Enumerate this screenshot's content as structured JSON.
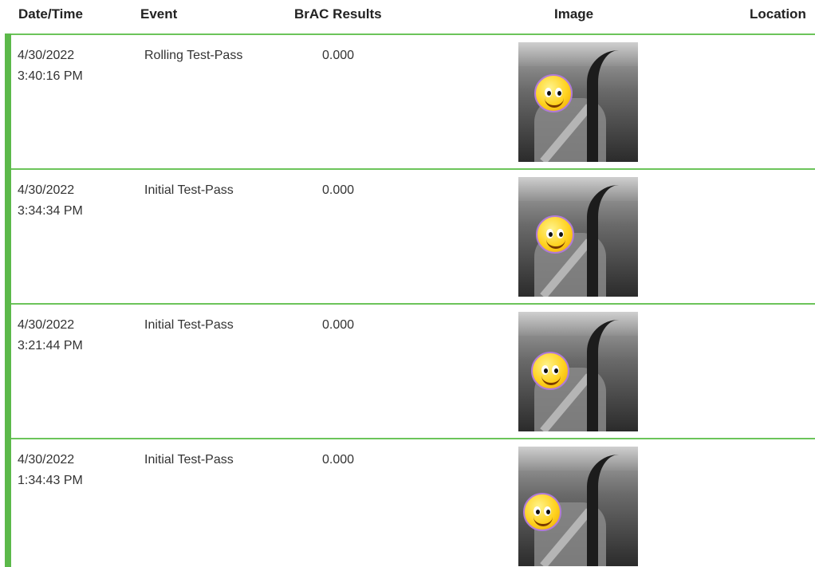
{
  "table": {
    "headers": {
      "datetime": "Date/Time",
      "event": "Event",
      "brac": "BrAC Results",
      "image": "Image",
      "location": "Location"
    },
    "rows": [
      {
        "date": "4/30/2022",
        "time": "3:40:16 PM",
        "event": "Rolling Test-Pass",
        "brac": "0.000",
        "location": ""
      },
      {
        "date": "4/30/2022",
        "time": "3:34:34 PM",
        "event": "Initial Test-Pass",
        "brac": "0.000",
        "location": ""
      },
      {
        "date": "4/30/2022",
        "time": "3:21:44 PM",
        "event": "Initial Test-Pass",
        "brac": "0.000",
        "location": ""
      },
      {
        "date": "4/30/2022",
        "time": "1:34:43 PM",
        "event": "Initial Test-Pass",
        "brac": "0.000",
        "location": ""
      }
    ]
  },
  "colors": {
    "accent": "#5cb94a",
    "row_border": "#6cc45a"
  },
  "icons": {
    "face_mask": "smiley-face-icon"
  }
}
